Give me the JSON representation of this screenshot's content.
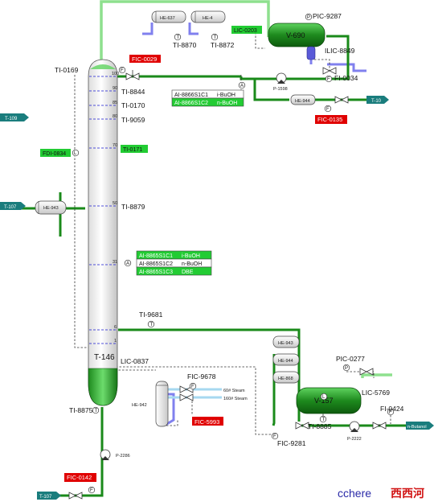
{
  "colors": {
    "pipe_green": "#1a8a1a",
    "pipe_light_green": "#8ee08e",
    "pipe_blue": "#8080ee",
    "pipe_steam": "#a6d8f0",
    "teal_connector": "#1a7d7d",
    "alarm_red": "#e00000",
    "tag_green": "#22cc33",
    "vessel_green": "#1e8a1e"
  },
  "column": {
    "name": "T-146",
    "tray_labels": [
      "100",
      "90",
      "85",
      "80",
      "70",
      "50",
      "31",
      "6",
      "1"
    ]
  },
  "vessels": {
    "v690": "V-690",
    "v157": "V-157"
  },
  "exchangers": {
    "he637": "HE-637",
    "he4": "HE-4",
    "he944_top": "HE-944",
    "he943_side": "HE-943",
    "he942": "HE-942",
    "he943": "HE-943",
    "he944": "HE-944",
    "he868": "HE-868"
  },
  "pumps": {
    "p1598": "P-1598",
    "p2286": "P-2286",
    "p2222": "P-2222"
  },
  "connectors": {
    "t109": "T-109",
    "t107_mid": "T-107",
    "t107_bot": "T-107",
    "t10": "T-10",
    "n_butanol": "n-Butanol"
  },
  "alarm_tags": {
    "fic0029": "FIC-0029",
    "fic0135": "FIC-0135",
    "fic5993": "FIC-5993",
    "fic0142": "FIC-0142"
  },
  "green_tags": {
    "lic0203": "LIC-0203",
    "fdi0834": "FDI-0834",
    "ti0171": "TI-0171"
  },
  "instruments": {
    "ti0169": "TI-0169",
    "ti8844": "TI-8844",
    "ti0170": "TI-0170",
    "ti9059": "TI-9059",
    "ti8879": "TI-8879",
    "ti9681": "TI-9681",
    "ti8870": "TI-8870",
    "ti8872": "TI-8872",
    "pic9287": "PIC-9287",
    "ilic8849": "ILIC-8849",
    "fi0034": "FI-0034",
    "lic0837": "LIC-0837",
    "fic9678": "FIC-9678",
    "ti8875": "TI-8875",
    "pic0277": "PIC-0277",
    "lic5769": "LIC-5769",
    "fi0424": "FI-0424",
    "ti8885": "TI-8885",
    "fic9281": "FIC-9281"
  },
  "analyzers": {
    "top": [
      {
        "tag": "AI-8866S1C1",
        "component": "i-BuOH"
      },
      {
        "tag": "AI-8866S1C2",
        "component": "n-BuOH"
      }
    ],
    "side": [
      {
        "tag": "AI-8865S1C1",
        "component": "i-BuOH"
      },
      {
        "tag": "AI-8865S1C2",
        "component": "n-BuOH"
      },
      {
        "tag": "AI-8865S1C3",
        "component": "DBE"
      }
    ]
  },
  "steam": {
    "s60": "60# Steam",
    "s160": "160# Steam"
  },
  "symbols": {
    "T": "T",
    "F": "F",
    "P": "P",
    "A": "A",
    "L": "L"
  },
  "watermark": {
    "brand": "cchere",
    "cn": "西西河"
  }
}
